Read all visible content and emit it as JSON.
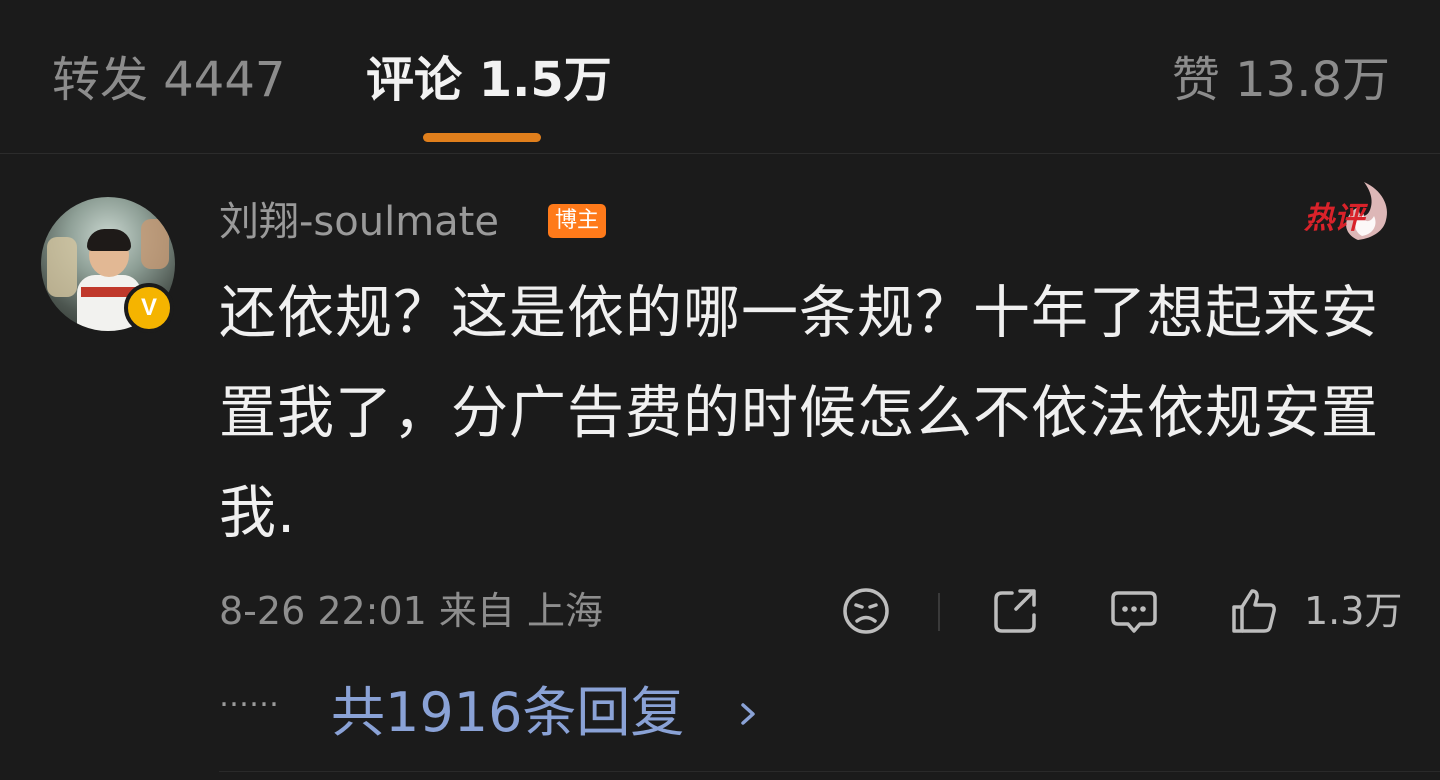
{
  "tabs": {
    "repost": "转发 4447",
    "comment": "评论 1.5万",
    "like": "赞 13.8万",
    "active_color": "#e07f1c"
  },
  "comment": {
    "username": "刘翔-soulmate",
    "badge": "博主",
    "hot_label": "热评",
    "text": "还依规？这是依的哪一条规？十年了想起来安置我了，分广告费的时候怎么不依法依规安置我.",
    "verified": "V",
    "meta": "8-26 22:01 来自 上海",
    "like_count": "1.3万",
    "ellipsis": "……",
    "replies_label": "共1916条回复",
    "icons": [
      "sad-face-icon",
      "share-icon",
      "comment-icon",
      "thumbs-up-icon",
      "chevron-right-icon"
    ]
  },
  "colors": {
    "background": "#1b1b1b",
    "badge": "#ff7a1a",
    "hot": "#d9222a",
    "link": "#8aa2d6",
    "verified": "#f5b400"
  }
}
